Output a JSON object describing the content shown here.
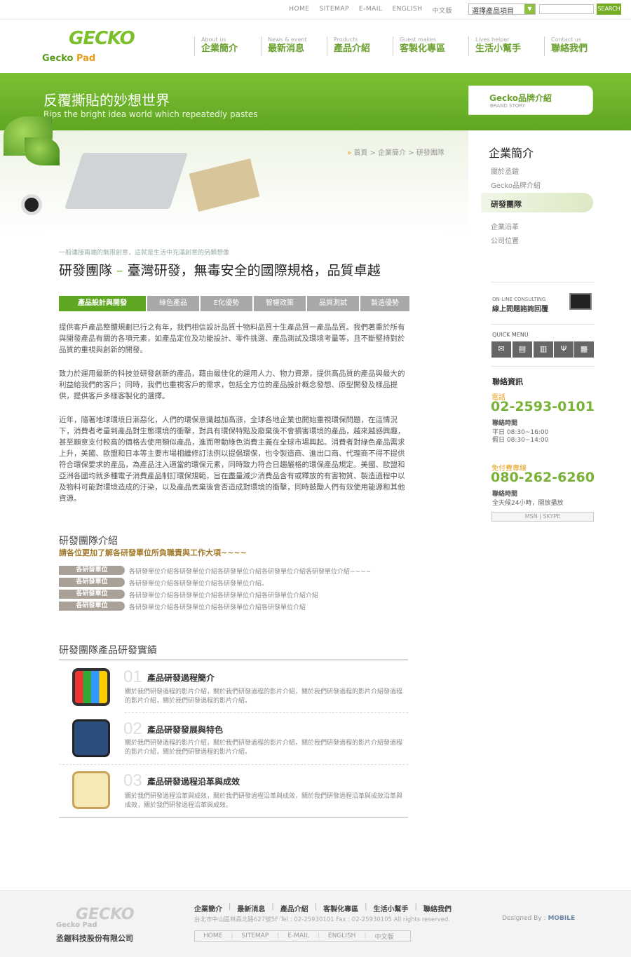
{
  "topbar": {
    "links": [
      "HOME",
      "SITEMAP",
      "E-MAIL",
      "ENGLISH",
      "中文版"
    ],
    "select_value": "選擇產品項目",
    "search_button": "SEARCH",
    "search_placeholder": ""
  },
  "logo": {
    "word": "GECKO",
    "line1": "Gecko",
    "line2": "Pad"
  },
  "nav": [
    {
      "en": "About us",
      "zh": "企業簡介"
    },
    {
      "en": "News & event",
      "zh": "最新消息"
    },
    {
      "en": "Products",
      "zh": "產品介紹"
    },
    {
      "en": "Guest makes",
      "zh": "客製化專區"
    },
    {
      "en": "Lives helper",
      "zh": "生活小幫手"
    },
    {
      "en": "Contact us",
      "zh": "聯絡我們"
    }
  ],
  "banner": {
    "title": "反覆撕貼的妙想世界",
    "subtitle": "Rips the bright idea world which repeatedly pastes",
    "brand_title": "Gecko品牌介紹",
    "brand_sub": "BRAND STORY"
  },
  "breadcrumb": "首頁 > 企業簡介 > 研發團隊",
  "main": {
    "slogan": "一般連接兩端的無限創意，這就是生活中充滿創意的另類想像",
    "title_a": "研發團隊",
    "title_dash": " – ",
    "title_b": "臺灣研發，無毒安全的國際規格，品質卓越",
    "tabs": [
      "產品設計與開發",
      "綠色產品",
      "E化優勢",
      "智權政策",
      "品質測試",
      "製造優勢"
    ],
    "paragraphs": [
      "提供客戶產品整體規劃已行之有年，我們相信設計品質十物料品質十生產品質一產品品質。我們著重於所有與開發產品有關的各項元素，如產品定位及功能設計、零件挑選、產品測試及環境考量等，且不斷堅持對於品質的重視與創新的開發。",
      "致力於運用最新的科技並研發創新的產品，藉由最佳化的運用人力、物力資源，提供高品質的產品與最大的利益給我們的客戶；同時，我們也重視客戶的需求，包括全方位的產品設計概念發想、原型開發及樣品提供，提供客戶多樣客製化的選擇。",
      "近年，隨著地球環境日漸惡化，人們的環保意識越加高漲，全球各地企業也開始重視環保問題，在這情況下，消費者考量到產品對生態環境的衝擊，對具有環保特點及廢棄後不會損害環境的產品，越來越感興趣，甚至願意支付較高的價格去使用類似產品，進而帶動綠色消費主義在全球市場興起。消費者對綠色產品需求上升，美國、歐盟和日本等主要市場相繼修訂法例以提倡環保，也令製造商、進出口商、代理商不得不提供符合環保要求的產品，為產品注入適當的環保元素，同時致力符合日趨嚴格的環保產品規定。美國、歐盟和亞洲各國均就多種電子消費產品制訂環保規範，旨在盡量減少消費品含有或釋放的有害物質、製造過程中以及物料可能對環境造成的汙染，以及產品丟棄後會否造成對環境的衝擊，同時鼓勵人們有效使用能源和其他資源。"
    ],
    "intro_heading": "研發團隊介紹",
    "intro_sub": "請各位更加了解各研發單位所負職責與工作大項~~~~",
    "units": [
      {
        "label": "各研發單位",
        "text": "各研發單位介紹各研發單位介紹各研發單位介紹各研發單位介紹各研發單位介紹~~~~"
      },
      {
        "label": "各研發單位",
        "text": "各研發單位介紹各研發單位介紹各研發單位介紹。"
      },
      {
        "label": "各研發單位",
        "text": "各研發單位介紹各研發單位介紹各研發單位介紹各研發單位介紹介紹"
      },
      {
        "label": "各研發單位",
        "text": "各研發單位介紹各研發單位介紹各研發單位介紹各研發單位介紹"
      }
    ],
    "results_heading": "研發團隊產品研發實績",
    "results": [
      {
        "num": "01",
        "title": "產品研發過程簡介",
        "desc": "關於我們研發過程的影片介紹，關於我們研發過程的影片介紹，關於我們研發過程的影片介紹發過程的影片介紹，關於我們研發過程的影片介紹。"
      },
      {
        "num": "02",
        "title": "產品研發發展與特色",
        "desc": "關於我們研發過程的影片介紹，關於我們研發過程的影片介紹，關於我們研發過程的影片介紹發過程的影片介紹，關於我們研發過程的影片介紹。"
      },
      {
        "num": "03",
        "title": "產品研發過程沿革與成效",
        "desc": "關於我們研發過程沿革與成效，關於我們研發過程沿革與成效，關於我們研發過程沿革與成效沿革與成效，關於我們研發過程沿革與成效。"
      }
    ]
  },
  "sidebar": {
    "heading": "企業簡介",
    "links": [
      "關於丞鎧",
      "Gecko品牌介紹",
      "研發團隊",
      "企業沿革",
      "公司位置"
    ],
    "online_en": "ON-LINE CONSULTING",
    "online_zh": "線上問題諮詢回覆",
    "quick_menu": "QUICK MENU",
    "contact_heading": "聯絡資訊",
    "phone_label": "電話",
    "phone": "02-2593-0101",
    "hours_label": "聯絡時間",
    "hours_weekday": "平日 08:30~16:00",
    "hours_holiday": "假日 08:30~14:00",
    "tollfree_label": "免付費專線",
    "tollfree": "080-262-6260",
    "hours_label2": "聯絡時間",
    "hours_all": "全天候24小時，開放播放",
    "msn": "MSN  |  SKYPE"
  },
  "footer": {
    "logo": "GECKO",
    "logo_pad": "Gecko Pad",
    "company": "丞鎧科技股份有限公司",
    "nav": [
      "企業簡介",
      "最新消息",
      "產品介紹",
      "客製化專區",
      "生活小幫手",
      "聯絡我們"
    ],
    "address": "台北市中山區林森北路627號5F  Tel : 02-25930101  Fax : 02-25930105  All rights reserved.",
    "links": [
      "HOME",
      "SITEMAP",
      "E-MAIL",
      "ENGLISH",
      "中文版"
    ],
    "designed_by": "Designed By :",
    "designer": "MOBILE"
  },
  "colors": {
    "brand_green": "#6aa12f",
    "accent_orange": "#e79c1a",
    "tab_gray": "#a8a8a8"
  }
}
